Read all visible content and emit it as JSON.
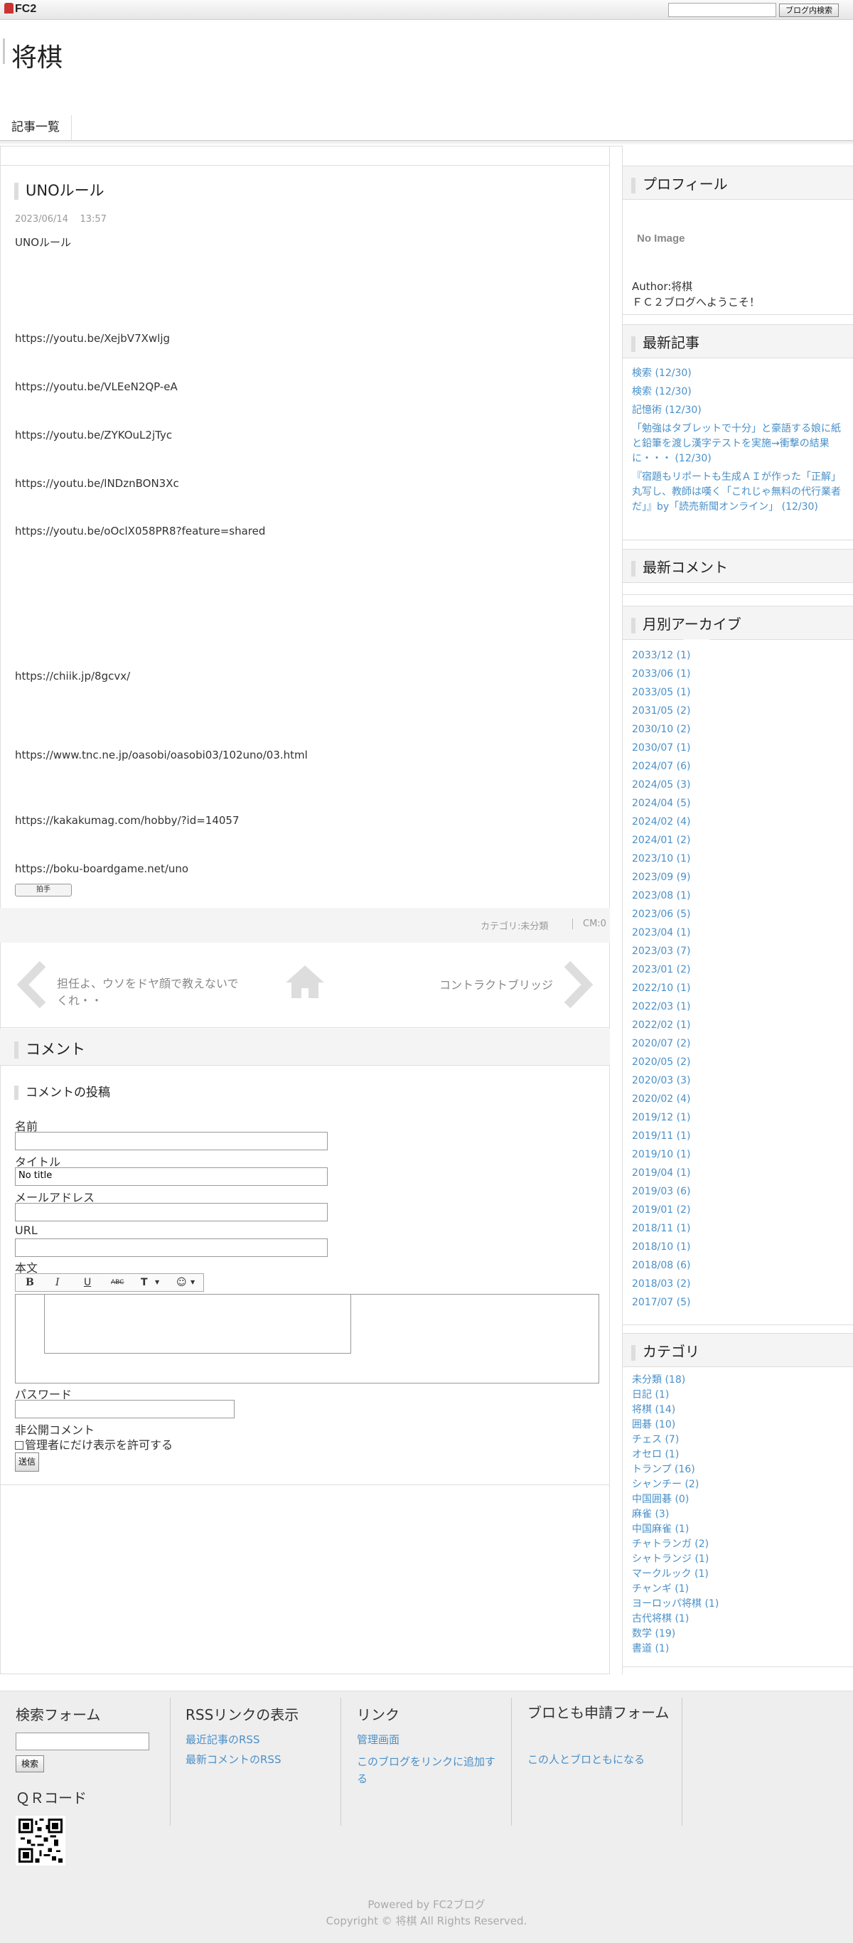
{
  "topbar": {
    "logo": "FC2",
    "search_button": "ブログ内検索"
  },
  "header": {
    "title": "将棋"
  },
  "nav": {
    "items": [
      {
        "label": "記事一覧"
      }
    ]
  },
  "entry": {
    "title": "UNOルール",
    "date": "2023/06/14",
    "time": "13:57",
    "lines": [
      "UNOルール",
      "https://youtu.be/XejbV7Xwljg",
      "https://youtu.be/VLEeN2QP-eA",
      "https://youtu.be/ZYKOuL2jTyc",
      "https://youtu.be/lNDznBON3Xc",
      "https://youtu.be/oOclX058PR8?feature=shared",
      "https://chiik.jp/8gcvx/",
      "https://www.tnc.ne.jp/oasobi/oasobi03/102uno/03.html",
      "https://kakakumag.com/hobby/?id=14057",
      "https://boku-boardgame.net/uno"
    ],
    "clap": "拍手",
    "category": "カテゴリ:未分類",
    "comment_count": "CM:0"
  },
  "pager": {
    "prev": "担任よ、ウソをドヤ顔で教えないでくれ・・",
    "next": "コントラクトブリッジ"
  },
  "comments": {
    "title": "コメント",
    "post_title": "コメントの投稿",
    "name_label": "名前",
    "title_label": "タイトル",
    "title_value": "No title",
    "email_label": "メールアドレス",
    "url_label": "URL",
    "body_label": "本文",
    "toolbar": {
      "bold": "B",
      "italic": "I",
      "underline": "U",
      "strike": "ABC",
      "color": "T",
      "emoji": "☺"
    },
    "password_label": "パスワード",
    "private_label": "非公開コメント",
    "private_checkbox": "管理者にだけ表示を許可する",
    "submit": "送信"
  },
  "sidebar": {
    "profile": {
      "title": "プロフィール",
      "no_image": "No Image",
      "author": "Author:将棋",
      "welcome": "ＦＣ２ブログへようこそ！"
    },
    "recent": {
      "title": "最新記事",
      "items": [
        "検索 (12/30)",
        "検索 (12/30)",
        "記憶術 (12/30)",
        "「勉強はタブレットで十分」と豪語する娘に紙と鉛筆を渡し漢字テストを実施→衝撃の結果に・・・ (12/30)",
        "『宿題もリポートも生成ＡＩが作った「正解」丸写し、教師は嘆く「これじゃ無料の代行業者だ」』by「読売新聞オンライン」 (12/30)"
      ]
    },
    "recent_comments": {
      "title": "最新コメント"
    },
    "archive": {
      "title": "月別アーカイブ",
      "items": [
        "2033/12 (1)",
        "2033/06 (1)",
        "2033/05 (1)",
        "2031/05 (2)",
        "2030/10 (2)",
        "2030/07 (1)",
        "2024/07 (6)",
        "2024/05 (3)",
        "2024/04 (5)",
        "2024/02 (4)",
        "2024/01 (2)",
        "2023/10 (1)",
        "2023/09 (9)",
        "2023/08 (1)",
        "2023/06 (5)",
        "2023/04 (1)",
        "2023/03 (7)",
        "2023/01 (2)",
        "2022/10 (1)",
        "2022/03 (1)",
        "2022/02 (1)",
        "2020/07 (2)",
        "2020/05 (2)",
        "2020/03 (3)",
        "2020/02 (4)",
        "2019/12 (1)",
        "2019/11 (1)",
        "2019/10 (1)",
        "2019/04 (1)",
        "2019/03 (6)",
        "2019/01 (2)",
        "2018/11 (1)",
        "2018/10 (1)",
        "2018/08 (6)",
        "2018/03 (2)",
        "2017/07 (5)"
      ]
    },
    "categories": {
      "title": "カテゴリ",
      "items": [
        "未分類 (18)",
        "日記 (1)",
        "将棋 (14)",
        "囲碁 (10)",
        "チェス (7)",
        "オセロ (1)",
        "トランプ (16)",
        "シャンチー (2)",
        "中国囲碁 (0)",
        "麻雀 (3)",
        "中国麻雀 (1)",
        "チャトランガ (2)",
        "シャトランジ (1)",
        "マークルック (1)",
        "チャンギ (1)",
        "ヨーロッパ将棋 (1)",
        "古代将棋 (1)",
        "数学 (19)",
        "書道 (1)"
      ]
    }
  },
  "footer": {
    "search": {
      "title": "検索フォーム",
      "button": "検索"
    },
    "qr": {
      "title": "ＱＲコード"
    },
    "rss": {
      "title": "RSSリンクの表示",
      "links": [
        "最近記事のRSS",
        "最新コメントのRSS"
      ]
    },
    "links": {
      "title": "リンク",
      "links": [
        "管理画面",
        "このブログをリンクに追加する"
      ]
    },
    "friend": {
      "title": "ブロとも申請フォーム",
      "links": [
        "この人とブロともになる"
      ]
    },
    "powered": "Powered by FC2ブログ",
    "copyright": "Copyright © 将棋 All Rights Reserved."
  }
}
